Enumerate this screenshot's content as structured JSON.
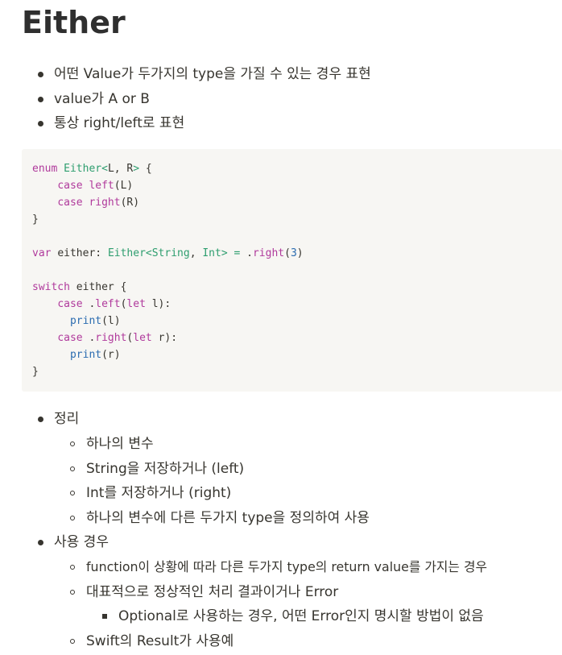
{
  "title": "Either",
  "intro": [
    "어떤 Value가 두가지의 type을 가질 수 있는 경우 표현",
    "value가 A or B",
    "통상 right/left로 표현"
  ],
  "code": {
    "line1": {
      "kw": "enum",
      "type": "Either",
      "lt": "<",
      "l": "L",
      "comma": ",",
      "r": "R",
      "gt": ">",
      "brace": "{"
    },
    "line2": {
      "kw": "case",
      "fn": "left",
      "arg": "(L)"
    },
    "line3": {
      "kw": "case",
      "fn": "right",
      "arg": "(R)"
    },
    "line4": "}",
    "line6": {
      "kw": "var",
      "name": "either:",
      "type": "Either",
      "lt": "<",
      "t1": "String",
      "comma": ",",
      "t2": "Int",
      "gt": ">",
      "eq": "=",
      "dot": ".",
      "fn": "right",
      "open": "(",
      "num": "3",
      "close": ")"
    },
    "line8": {
      "kw": "switch",
      "rest": "either {"
    },
    "line9": {
      "kw": "case",
      "dot": ".",
      "fn": "left",
      "open": "(",
      "kw2": "let",
      "rest": "l):"
    },
    "line10": {
      "fn": "print",
      "arg": "(l)"
    },
    "line11": {
      "kw": "case",
      "dot": ".",
      "fn": "right",
      "open": "(",
      "kw2": "let",
      "rest": "r):"
    },
    "line12": {
      "fn": "print",
      "arg": "(r)"
    },
    "line13": "}"
  },
  "summary": {
    "label": "정리",
    "items": [
      "하나의 변수",
      "String을 저장하거나 (left)",
      "Int를 저장하거나 (right)",
      "하나의 변수에 다른 두가지 type을 정의하여 사용"
    ]
  },
  "usage": {
    "label": "사용 경우",
    "items": [
      "function이 상황에 따라 다른 두가지 type의 return value를 가지는 경우",
      "대표적으로 정상적인 처리 결과이거나 Error"
    ],
    "sub": "Optional로 사용하는 경우, 어떤 Error인지 명시할 방법이 없음",
    "last": "Swift의 Result가 사용예"
  }
}
